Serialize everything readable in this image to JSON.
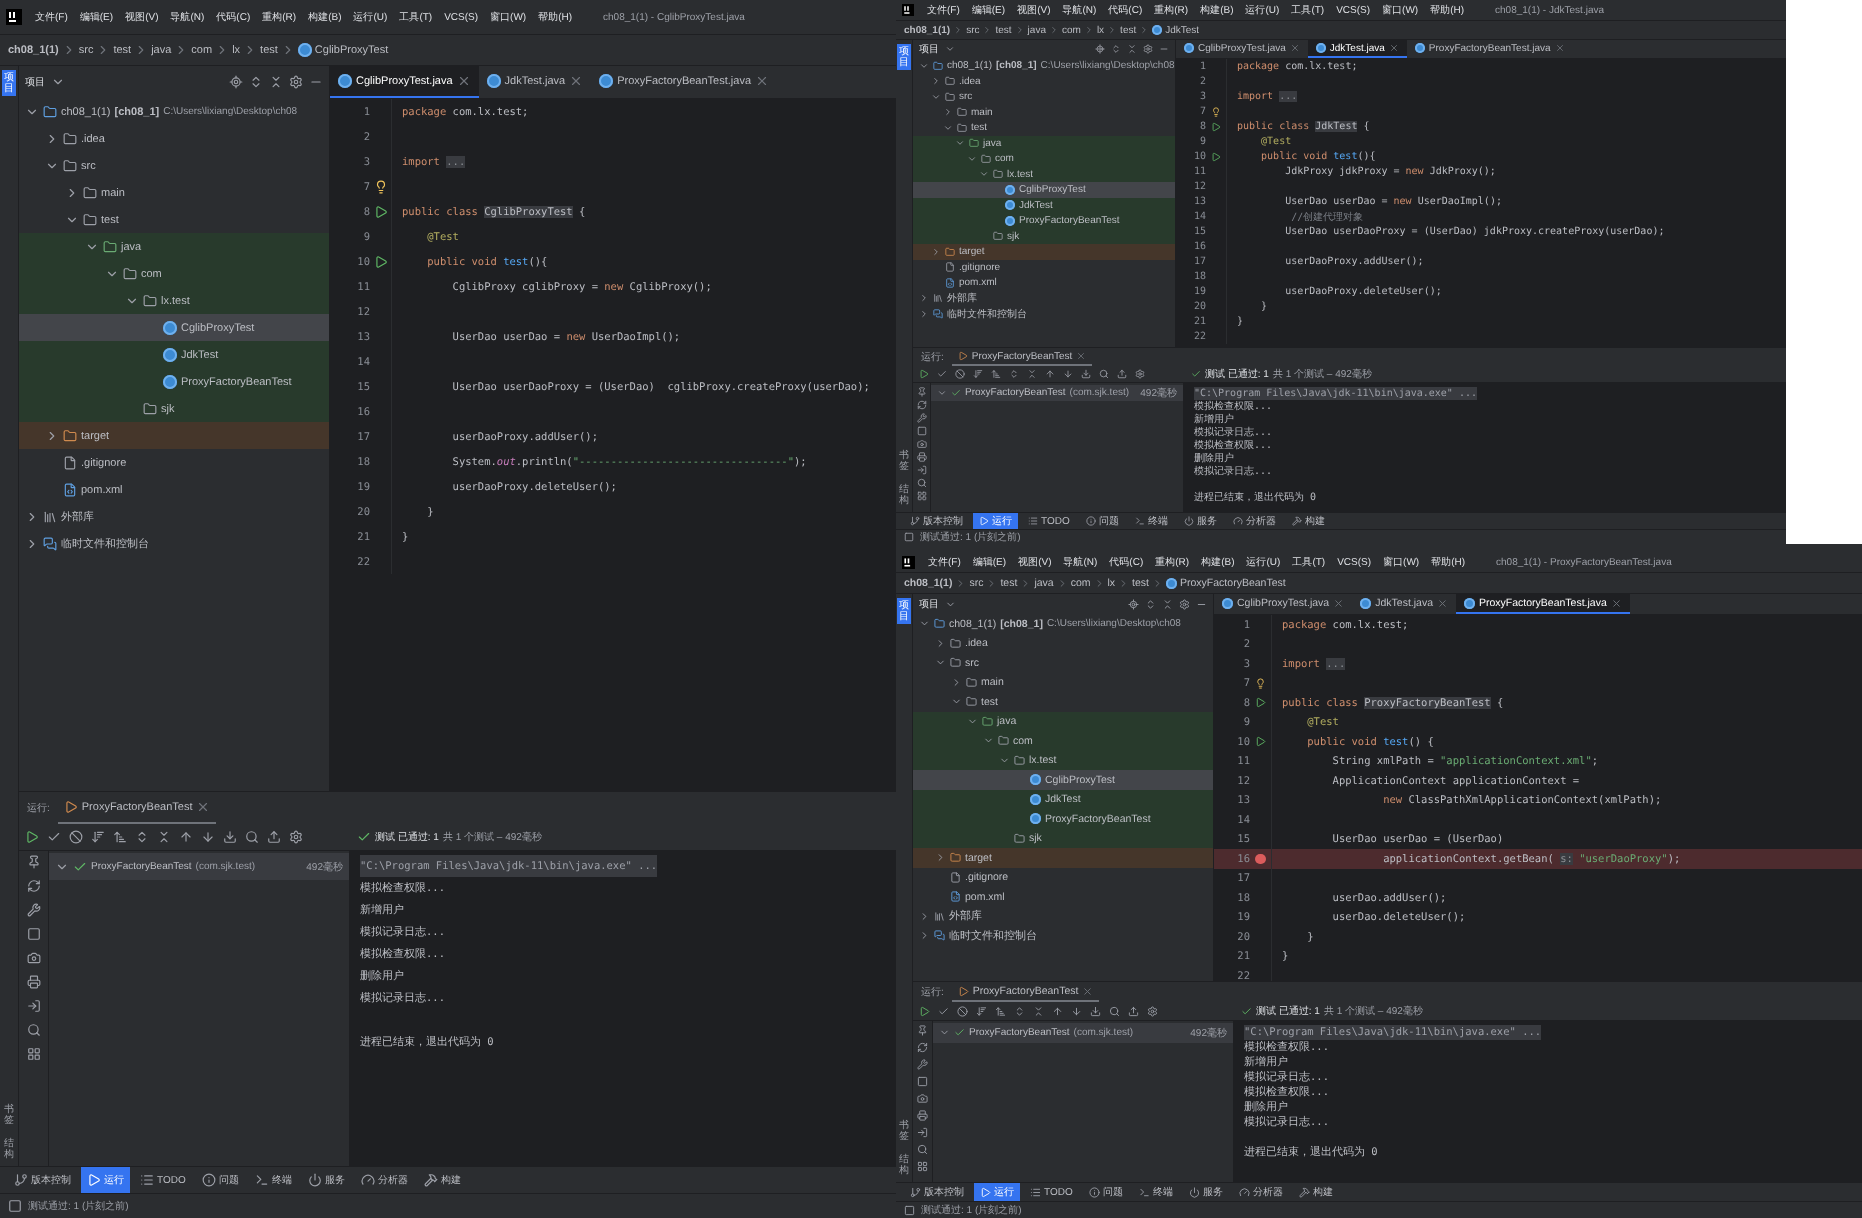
{
  "screens": [
    {
      "menu": [
        "文件(F)",
        "编辑(E)",
        "视图(V)",
        "导航(N)",
        "代码(C)",
        "重构(R)",
        "构建(B)",
        "运行(U)",
        "工具(T)",
        "VCS(S)",
        "窗口(W)",
        "帮助(H)"
      ],
      "title": "ch08_1(1) - CglibProxyTest.java",
      "breadcrumbs": [
        "ch08_1(1)",
        "src",
        "test",
        "java",
        "com",
        "lx",
        "test",
        "CglibProxyTest"
      ],
      "left_strip": {
        "top": [
          {
            "label": "项目",
            "selected": true
          }
        ],
        "bottom": [
          "书签",
          "结构"
        ]
      },
      "project_panel": {
        "title": "项目",
        "tree": [
          {
            "label": "ch08_1(1)",
            "kind": "module",
            "module": "[ch08_1]",
            "path": "C:\\Users\\lixiang\\Desktop\\ch08",
            "expanded": true,
            "selected": false,
            "children": [
              {
                "label": ".idea",
                "kind": "folder",
                "expanded": false,
                "selected": false
              },
              {
                "label": "src",
                "kind": "folder",
                "expanded": true,
                "selected": false,
                "children": [
                  {
                    "label": "main",
                    "kind": "folder",
                    "expanded": false,
                    "selected": false
                  },
                  {
                    "label": "test",
                    "kind": "folder",
                    "expanded": true,
                    "selected": false,
                    "children": [
                      {
                        "label": "java",
                        "kind": "test-folder",
                        "expanded": true,
                        "selected": false,
                        "children": [
                          {
                            "label": "com",
                            "kind": "package",
                            "expanded": true,
                            "selected": false,
                            "children": [
                              {
                                "label": "lx.test",
                                "kind": "package",
                                "expanded": true,
                                "selected": false,
                                "children": [
                                  {
                                    "label": "CglibProxyTest",
                                    "kind": "class",
                                    "selected": true
                                  },
                                  {
                                    "label": "JdkTest",
                                    "kind": "class",
                                    "selected": false
                                  },
                                  {
                                    "label": "ProxyFactoryBeanTest",
                                    "kind": "class",
                                    "selected": false
                                  }
                                ]
                              },
                              {
                                "label": "sjk",
                                "kind": "package",
                                "selected": false
                              }
                            ]
                          }
                        ]
                      }
                    ]
                  }
                ]
              },
              {
                "label": "target",
                "kind": "excluded-folder",
                "expanded": false,
                "selected": false
              },
              {
                "label": ".gitignore",
                "kind": "git-file",
                "selected": false
              },
              {
                "label": "pom.xml",
                "kind": "maven-file",
                "selected": false
              }
            ]
          },
          {
            "label": "外部库",
            "kind": "library",
            "expanded": false,
            "selected": false
          },
          {
            "label": "临时文件和控制台",
            "kind": "scratch",
            "expanded": false,
            "selected": false
          }
        ]
      },
      "editor": {
        "tabs": [
          {
            "label": "CglibProxyTest.java",
            "selected": true
          },
          {
            "label": "JdkTest.java",
            "selected": false
          },
          {
            "label": "ProxyFactoryBeanTest.java",
            "selected": false
          }
        ],
        "lines": [
          {
            "num": "1",
            "kind": "plain",
            "tokens": [
              {
                "kind": "kw",
                "text": "package"
              },
              {
                "kind": "plain",
                "text": " com.lx.test;"
              }
            ]
          },
          {
            "num": "2",
            "kind": "plain"
          },
          {
            "num": "3",
            "kind": "plain",
            "tokens": [
              {
                "kind": "kw",
                "text": "import "
              },
              {
                "kind": "fold",
                "text": "..."
              }
            ]
          },
          {
            "num": "7",
            "kind": "bulb"
          },
          {
            "num": "8",
            "kind": "run",
            "tokens": [
              {
                "kind": "kw",
                "text": "public class "
              },
              {
                "kind": "decl",
                "text": "CglibProxyTest"
              },
              {
                "kind": "plain",
                "text": " {"
              }
            ]
          },
          {
            "num": "9",
            "kind": "plain",
            "tokens": [
              {
                "kind": "ann",
                "text": "    @Test"
              }
            ]
          },
          {
            "num": "10",
            "kind": "run",
            "tokens": [
              {
                "kind": "kw",
                "text": "    public void "
              },
              {
                "kind": "fn",
                "text": "test"
              },
              {
                "kind": "plain",
                "text": "(){"
              }
            ]
          },
          {
            "num": "11",
            "kind": "plain",
            "tokens": [
              {
                "kind": "plain",
                "text": "        CglibProxy cglibProxy = "
              },
              {
                "kind": "kw",
                "text": "new"
              },
              {
                "kind": "plain",
                "text": " CglibProxy();"
              }
            ]
          },
          {
            "num": "12",
            "kind": "plain"
          },
          {
            "num": "13",
            "kind": "plain",
            "tokens": [
              {
                "kind": "plain",
                "text": "        UserDao userDao = "
              },
              {
                "kind": "kw",
                "text": "new"
              },
              {
                "kind": "plain",
                "text": " UserDaoImpl();"
              }
            ]
          },
          {
            "num": "14",
            "kind": "plain"
          },
          {
            "num": "15",
            "kind": "plain",
            "tokens": [
              {
                "kind": "plain",
                "text": "        UserDao userDaoProxy = (UserDao)  cglibProxy.createProxy(userDao);"
              }
            ]
          },
          {
            "num": "16",
            "kind": "plain"
          },
          {
            "num": "17",
            "kind": "plain",
            "tokens": [
              {
                "kind": "plain",
                "text": "        userDaoProxy.addUser();"
              }
            ]
          },
          {
            "num": "18",
            "kind": "plain",
            "tokens": [
              {
                "kind": "plain",
                "text": "        System."
              },
              {
                "kind": "field",
                "text": "out"
              },
              {
                "kind": "plain",
                "text": ".println("
              },
              {
                "kind": "str",
                "text": "\"---------------------------------\""
              },
              {
                "kind": "plain",
                "text": ");"
              }
            ]
          },
          {
            "num": "19",
            "kind": "plain",
            "tokens": [
              {
                "kind": "plain",
                "text": "        userDaoProxy.deleteUser();"
              }
            ]
          },
          {
            "num": "20",
            "kind": "plain",
            "tokens": [
              {
                "kind": "plain",
                "text": "    }"
              }
            ]
          },
          {
            "num": "21",
            "kind": "plain",
            "tokens": [
              {
                "kind": "plain",
                "text": "}"
              }
            ]
          },
          {
            "num": "22",
            "kind": "plain"
          }
        ]
      },
      "run_panel": {
        "label": "运行:",
        "tab": "ProxyFactoryBeanTest",
        "result": "测试 已通过: 1",
        "detail": "共 1 个测试 – 492毫秒",
        "tests": [
          {
            "name": "ProxyFactoryBeanTest",
            "package": "(com.sjk.test)",
            "time": "492毫秒",
            "passed": true,
            "expanded": true
          }
        ],
        "output": [
          {
            "kind": "command",
            "text": "\"C:\\Program Files\\Java\\jdk-11\\bin\\java.exe\" ..."
          },
          {
            "kind": "plain",
            "text": "模拟检查权限..."
          },
          {
            "kind": "plain",
            "text": "新增用户"
          },
          {
            "kind": "plain",
            "text": "模拟记录日志..."
          },
          {
            "kind": "plain",
            "text": "模拟检查权限..."
          },
          {
            "kind": "plain",
            "text": "删除用户"
          },
          {
            "kind": "plain",
            "text": "模拟记录日志..."
          },
          {
            "kind": "exit",
            "text": "进程已结束，退出代码为 0"
          }
        ]
      },
      "tool_tabs": [
        {
          "label": "版本控制",
          "selected": false
        },
        {
          "label": "运行",
          "selected": true
        },
        {
          "label": "TODO",
          "selected": false
        },
        {
          "label": "问题",
          "selected": false
        },
        {
          "label": "终端",
          "selected": false
        },
        {
          "label": "服务",
          "selected": false
        },
        {
          "label": "分析器",
          "selected": false
        },
        {
          "label": "构建",
          "selected": false
        }
      ],
      "status_bar": "测试通过: 1 (片刻之前)"
    },
    {
      "menu": [
        "文件(F)",
        "编辑(E)",
        "视图(V)",
        "导航(N)",
        "代码(C)",
        "重构(R)",
        "构建(B)",
        "运行(U)",
        "工具(T)",
        "VCS(S)",
        "窗口(W)",
        "帮助(H)"
      ],
      "title": "ch08_1(1) - JdkTest.java",
      "breadcrumbs": [
        "ch08_1(1)",
        "src",
        "test",
        "java",
        "com",
        "lx",
        "test",
        "JdkTest"
      ],
      "left_strip": {
        "top": [
          {
            "label": "项目",
            "selected": true
          }
        ],
        "bottom": [
          "书签",
          "结构"
        ]
      },
      "project_panel": {
        "title": "项目",
        "tree": [
          {
            "label": "ch08_1(1)",
            "kind": "module",
            "module": "[ch08_1]",
            "path": "C:\\Users\\lixiang\\Desktop\\ch08",
            "expanded": true,
            "selected": false,
            "children": [
              {
                "label": ".idea",
                "kind": "folder",
                "expanded": false,
                "selected": false
              },
              {
                "label": "src",
                "kind": "folder",
                "expanded": true,
                "selected": false,
                "children": [
                  {
                    "label": "main",
                    "kind": "folder",
                    "expanded": false,
                    "selected": false
                  },
                  {
                    "label": "test",
                    "kind": "folder",
                    "expanded": true,
                    "selected": false,
                    "children": [
                      {
                        "label": "java",
                        "kind": "test-folder",
                        "expanded": true,
                        "selected": false,
                        "children": [
                          {
                            "label": "com",
                            "kind": "package",
                            "expanded": true,
                            "selected": false,
                            "children": [
                              {
                                "label": "lx.test",
                                "kind": "package",
                                "expanded": true,
                                "selected": false,
                                "children": [
                                  {
                                    "label": "CglibProxyTest",
                                    "kind": "class",
                                    "selected": true
                                  },
                                  {
                                    "label": "JdkTest",
                                    "kind": "class",
                                    "selected": false
                                  },
                                  {
                                    "label": "ProxyFactoryBeanTest",
                                    "kind": "class",
                                    "selected": false
                                  }
                                ]
                              },
                              {
                                "label": "sjk",
                                "kind": "package",
                                "selected": false
                              }
                            ]
                          }
                        ]
                      }
                    ]
                  }
                ]
              },
              {
                "label": "target",
                "kind": "excluded-folder",
                "expanded": false,
                "selected": false
              },
              {
                "label": ".gitignore",
                "kind": "git-file",
                "selected": false
              },
              {
                "label": "pom.xml",
                "kind": "maven-file",
                "selected": false
              }
            ]
          },
          {
            "label": "外部库",
            "kind": "library",
            "expanded": false,
            "selected": false
          },
          {
            "label": "临时文件和控制台",
            "kind": "scratch",
            "expanded": false,
            "selected": false
          }
        ]
      },
      "editor": {
        "tabs": [
          {
            "label": "CglibProxyTest.java",
            "selected": false
          },
          {
            "label": "JdkTest.java",
            "selected": true
          },
          {
            "label": "ProxyFactoryBeanTest.java",
            "selected": false
          }
        ],
        "lines": [
          {
            "num": "1",
            "kind": "plain",
            "tokens": [
              {
                "kind": "kw",
                "text": "package"
              },
              {
                "kind": "plain",
                "text": " com.lx.test;"
              }
            ]
          },
          {
            "num": "2",
            "kind": "plain"
          },
          {
            "num": "3",
            "kind": "plain",
            "tokens": [
              {
                "kind": "kw",
                "text": "import "
              },
              {
                "kind": "fold",
                "text": "..."
              }
            ]
          },
          {
            "num": "7",
            "kind": "bulb"
          },
          {
            "num": "8",
            "kind": "run",
            "tokens": [
              {
                "kind": "kw",
                "text": "public class "
              },
              {
                "kind": "decl",
                "text": "JdkTest"
              },
              {
                "kind": "plain",
                "text": " {"
              }
            ]
          },
          {
            "num": "9",
            "kind": "plain",
            "tokens": [
              {
                "kind": "ann",
                "text": "    @Test"
              }
            ]
          },
          {
            "num": "10",
            "kind": "run",
            "tokens": [
              {
                "kind": "kw",
                "text": "    public void "
              },
              {
                "kind": "fn",
                "text": "test"
              },
              {
                "kind": "plain",
                "text": "(){"
              }
            ]
          },
          {
            "num": "11",
            "kind": "plain",
            "tokens": [
              {
                "kind": "plain",
                "text": "        JdkProxy jdkProxy = "
              },
              {
                "kind": "kw",
                "text": "new"
              },
              {
                "kind": "plain",
                "text": " JdkProxy();"
              }
            ]
          },
          {
            "num": "12",
            "kind": "plain"
          },
          {
            "num": "13",
            "kind": "plain",
            "tokens": [
              {
                "kind": "plain",
                "text": "        UserDao userDao = "
              },
              {
                "kind": "kw",
                "text": "new"
              },
              {
                "kind": "plain",
                "text": " UserDaoImpl();"
              }
            ]
          },
          {
            "num": "14",
            "kind": "plain",
            "tokens": [
              {
                "kind": "comment",
                "text": "         //创建代理对象"
              }
            ]
          },
          {
            "num": "15",
            "kind": "plain",
            "tokens": [
              {
                "kind": "plain",
                "text": "        UserDao userDaoProxy = (UserDao) jdkProxy.createProxy(userDao);"
              }
            ]
          },
          {
            "num": "16",
            "kind": "plain"
          },
          {
            "num": "17",
            "kind": "plain",
            "tokens": [
              {
                "kind": "plain",
                "text": "        userDaoProxy.addUser();"
              }
            ]
          },
          {
            "num": "18",
            "kind": "plain"
          },
          {
            "num": "19",
            "kind": "plain",
            "tokens": [
              {
                "kind": "plain",
                "text": "        userDaoProxy.deleteUser();"
              }
            ]
          },
          {
            "num": "20",
            "kind": "plain",
            "tokens": [
              {
                "kind": "plain",
                "text": "    }"
              }
            ]
          },
          {
            "num": "21",
            "kind": "plain",
            "tokens": [
              {
                "kind": "plain",
                "text": "}"
              }
            ]
          },
          {
            "num": "22",
            "kind": "plain"
          }
        ]
      },
      "run_panel": {
        "label": "运行:",
        "tab": "ProxyFactoryBeanTest",
        "result": "测试 已通过: 1",
        "detail": "共 1 个测试 – 492毫秒",
        "tests": [
          {
            "name": "ProxyFactoryBeanTest",
            "package": "(com.sjk.test)",
            "time": "492毫秒",
            "passed": true,
            "expanded": true
          }
        ],
        "output": [
          {
            "kind": "command",
            "text": "\"C:\\Program Files\\Java\\jdk-11\\bin\\java.exe\" ..."
          },
          {
            "kind": "plain",
            "text": "模拟检查权限..."
          },
          {
            "kind": "plain",
            "text": "新增用户"
          },
          {
            "kind": "plain",
            "text": "模拟记录日志..."
          },
          {
            "kind": "plain",
            "text": "模拟检查权限..."
          },
          {
            "kind": "plain",
            "text": "删除用户"
          },
          {
            "kind": "plain",
            "text": "模拟记录日志..."
          },
          {
            "kind": "exit",
            "text": "进程已结束，退出代码为 0"
          }
        ]
      },
      "tool_tabs": [
        {
          "label": "版本控制",
          "selected": false
        },
        {
          "label": "运行",
          "selected": true
        },
        {
          "label": "TODO",
          "selected": false
        },
        {
          "label": "问题",
          "selected": false
        },
        {
          "label": "终端",
          "selected": false
        },
        {
          "label": "服务",
          "selected": false
        },
        {
          "label": "分析器",
          "selected": false
        },
        {
          "label": "构建",
          "selected": false
        }
      ],
      "status_bar": "测试通过: 1 (片刻之前)"
    },
    {
      "menu": [
        "文件(F)",
        "编辑(E)",
        "视图(V)",
        "导航(N)",
        "代码(C)",
        "重构(R)",
        "构建(B)",
        "运行(U)",
        "工具(T)",
        "VCS(S)",
        "窗口(W)",
        "帮助(H)"
      ],
      "title": "ch08_1(1) - ProxyFactoryBeanTest.java",
      "breadcrumbs": [
        "ch08_1(1)",
        "src",
        "test",
        "java",
        "com",
        "lx",
        "test",
        "ProxyFactoryBeanTest"
      ],
      "left_strip": {
        "top": [
          {
            "label": "项目",
            "selected": true
          }
        ],
        "bottom": [
          "书签",
          "结构"
        ]
      },
      "project_panel": {
        "title": "项目",
        "tree": [
          {
            "label": "ch08_1(1)",
            "kind": "module",
            "module": "[ch08_1]",
            "path": "C:\\Users\\lixiang\\Desktop\\ch08",
            "expanded": true,
            "selected": false,
            "children": [
              {
                "label": ".idea",
                "kind": "folder",
                "expanded": false,
                "selected": false
              },
              {
                "label": "src",
                "kind": "folder",
                "expanded": true,
                "selected": false,
                "children": [
                  {
                    "label": "main",
                    "kind": "folder",
                    "expanded": false,
                    "selected": false
                  },
                  {
                    "label": "test",
                    "kind": "folder",
                    "expanded": true,
                    "selected": false,
                    "children": [
                      {
                        "label": "java",
                        "kind": "test-folder",
                        "expanded": true,
                        "selected": false,
                        "children": [
                          {
                            "label": "com",
                            "kind": "package",
                            "expanded": true,
                            "selected": false,
                            "children": [
                              {
                                "label": "lx.test",
                                "kind": "package",
                                "expanded": true,
                                "selected": false,
                                "children": [
                                  {
                                    "label": "CglibProxyTest",
                                    "kind": "class",
                                    "selected": true
                                  },
                                  {
                                    "label": "JdkTest",
                                    "kind": "class",
                                    "selected": false
                                  },
                                  {
                                    "label": "ProxyFactoryBeanTest",
                                    "kind": "class",
                                    "selected": false
                                  }
                                ]
                              },
                              {
                                "label": "sjk",
                                "kind": "package",
                                "selected": false
                              }
                            ]
                          }
                        ]
                      }
                    ]
                  }
                ]
              },
              {
                "label": "target",
                "kind": "excluded-folder",
                "expanded": false,
                "selected": false
              },
              {
                "label": ".gitignore",
                "kind": "git-file",
                "selected": false
              },
              {
                "label": "pom.xml",
                "kind": "maven-file",
                "selected": false
              }
            ]
          },
          {
            "label": "外部库",
            "kind": "library",
            "expanded": false,
            "selected": false
          },
          {
            "label": "临时文件和控制台",
            "kind": "scratch",
            "expanded": false,
            "selected": false
          }
        ]
      },
      "editor": {
        "tabs": [
          {
            "label": "CglibProxyTest.java",
            "selected": false
          },
          {
            "label": "JdkTest.java",
            "selected": false
          },
          {
            "label": "ProxyFactoryBeanTest.java",
            "selected": true
          }
        ],
        "lines": [
          {
            "num": "1",
            "kind": "plain",
            "tokens": [
              {
                "kind": "kw",
                "text": "package"
              },
              {
                "kind": "plain",
                "text": " com.lx.test;"
              }
            ]
          },
          {
            "num": "2",
            "kind": "plain"
          },
          {
            "num": "3",
            "kind": "plain",
            "tokens": [
              {
                "kind": "kw",
                "text": "import "
              },
              {
                "kind": "fold",
                "text": "..."
              }
            ]
          },
          {
            "num": "7",
            "kind": "bulb"
          },
          {
            "num": "8",
            "kind": "run",
            "tokens": [
              {
                "kind": "kw",
                "text": "public class "
              },
              {
                "kind": "decl",
                "text": "ProxyFactoryBeanTest"
              },
              {
                "kind": "plain",
                "text": " {"
              }
            ]
          },
          {
            "num": "9",
            "kind": "plain",
            "tokens": [
              {
                "kind": "ann",
                "text": "    @Test"
              }
            ]
          },
          {
            "num": "10",
            "kind": "run",
            "tokens": [
              {
                "kind": "kw",
                "text": "    public void "
              },
              {
                "kind": "fn",
                "text": "test"
              },
              {
                "kind": "plain",
                "text": "() {"
              }
            ]
          },
          {
            "num": "11",
            "kind": "plain",
            "tokens": [
              {
                "kind": "plain",
                "text": "        String xmlPath = "
              },
              {
                "kind": "str",
                "text": "\"applicationContext.xml\""
              },
              {
                "kind": "plain",
                "text": ";"
              }
            ]
          },
          {
            "num": "12",
            "kind": "plain",
            "tokens": [
              {
                "kind": "plain",
                "text": "        ApplicationContext applicationContext ="
              }
            ]
          },
          {
            "num": "13",
            "kind": "plain",
            "tokens": [
              {
                "kind": "kw",
                "text": "                new"
              },
              {
                "kind": "plain",
                "text": " ClassPathXmlApplicationContext(xmlPath);"
              }
            ]
          },
          {
            "num": "14",
            "kind": "plain"
          },
          {
            "num": "15",
            "kind": "plain",
            "tokens": [
              {
                "kind": "plain",
                "text": "        UserDao userDao = (UserDao)"
              }
            ]
          },
          {
            "num": "16",
            "kind": "breakpoint",
            "tokens": [
              {
                "kind": "plain",
                "text": "                applicationContext.getBean( "
              },
              {
                "kind": "hint",
                "text": "s:"
              },
              {
                "kind": "str",
                "text": " \"userDaoProxy\""
              },
              {
                "kind": "plain",
                "text": ");"
              }
            ]
          },
          {
            "num": "17",
            "kind": "plain"
          },
          {
            "num": "18",
            "kind": "plain",
            "tokens": [
              {
                "kind": "plain",
                "text": "        userDao.addUser();"
              }
            ]
          },
          {
            "num": "19",
            "kind": "plain",
            "tokens": [
              {
                "kind": "plain",
                "text": "        userDao.deleteUser();"
              }
            ]
          },
          {
            "num": "20",
            "kind": "plain",
            "tokens": [
              {
                "kind": "plain",
                "text": "    }"
              }
            ]
          },
          {
            "num": "21",
            "kind": "plain",
            "tokens": [
              {
                "kind": "plain",
                "text": "}"
              }
            ]
          },
          {
            "num": "22",
            "kind": "plain"
          }
        ]
      },
      "run_panel": {
        "label": "运行:",
        "tab": "ProxyFactoryBeanTest",
        "result": "测试 已通过: 1",
        "detail": "共 1 个测试 – 492毫秒",
        "tests": [
          {
            "name": "ProxyFactoryBeanTest",
            "package": "(com.sjk.test)",
            "time": "492毫秒",
            "passed": true,
            "expanded": true
          }
        ],
        "output": [
          {
            "kind": "command",
            "text": "\"C:\\Program Files\\Java\\jdk-11\\bin\\java.exe\" ..."
          },
          {
            "kind": "plain",
            "text": "模拟检查权限..."
          },
          {
            "kind": "plain",
            "text": "新增用户"
          },
          {
            "kind": "plain",
            "text": "模拟记录日志..."
          },
          {
            "kind": "plain",
            "text": "模拟检查权限..."
          },
          {
            "kind": "plain",
            "text": "删除用户"
          },
          {
            "kind": "plain",
            "text": "模拟记录日志..."
          },
          {
            "kind": "exit",
            "text": "进程已结束，退出代码为 0"
          }
        ]
      },
      "tool_tabs": [
        {
          "label": "版本控制",
          "selected": false
        },
        {
          "label": "运行",
          "selected": true
        },
        {
          "label": "TODO",
          "selected": false
        },
        {
          "label": "问题",
          "selected": false
        },
        {
          "label": "终端",
          "selected": false
        },
        {
          "label": "服务",
          "selected": false
        },
        {
          "label": "分析器",
          "selected": false
        },
        {
          "label": "构建",
          "selected": false
        }
      ],
      "status_bar": "测试通过: 1 (片刻之前)"
    }
  ]
}
